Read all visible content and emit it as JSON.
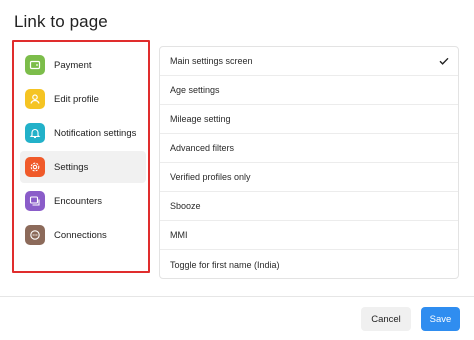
{
  "dialog": {
    "title": "Link to page"
  },
  "left_menu": {
    "items": [
      {
        "label": "Payment",
        "icon": "wallet-icon",
        "color": "#7cbd4a",
        "active": false
      },
      {
        "label": "Edit profile",
        "icon": "user-icon",
        "color": "#f5c423",
        "active": false
      },
      {
        "label": "Notification settings",
        "icon": "bell-icon",
        "color": "#22b1c9",
        "active": false
      },
      {
        "label": "Settings",
        "icon": "gear-icon",
        "color": "#f05a2a",
        "active": true
      },
      {
        "label": "Encounters",
        "icon": "cards-icon",
        "color": "#8a5cc9",
        "active": false
      },
      {
        "label": "Connections",
        "icon": "chat-icon",
        "color": "#8c6a5a",
        "active": false
      }
    ]
  },
  "right_list": {
    "items": [
      {
        "label": "Main settings screen",
        "selected": true
      },
      {
        "label": "Age settings",
        "selected": false
      },
      {
        "label": "Mileage setting",
        "selected": false
      },
      {
        "label": "Advanced filters",
        "selected": false
      },
      {
        "label": "Verified profiles only",
        "selected": false
      },
      {
        "label": "Sbooze",
        "selected": false
      },
      {
        "label": "MMI",
        "selected": false
      },
      {
        "label": "Toggle for first name (India)",
        "selected": false
      }
    ]
  },
  "footer": {
    "cancel_label": "Cancel",
    "save_label": "Save"
  }
}
